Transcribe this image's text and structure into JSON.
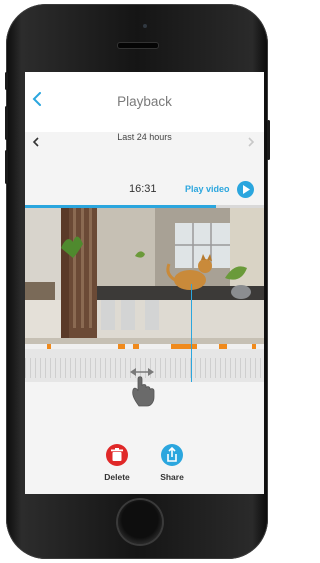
{
  "header": {
    "title": "Playback"
  },
  "range": {
    "label": "Last 24 hours"
  },
  "player": {
    "time": "16:31",
    "play_label": "Play video",
    "progress": 0.8
  },
  "timeline": {
    "events": [
      {
        "start": 0.09,
        "width": 0.02
      },
      {
        "start": 0.39,
        "width": 0.03
      },
      {
        "start": 0.45,
        "width": 0.025
      },
      {
        "start": 0.61,
        "width": 0.11
      },
      {
        "start": 0.81,
        "width": 0.035
      },
      {
        "start": 0.95,
        "width": 0.015
      }
    ],
    "cursor": 0.695
  },
  "actions": {
    "delete_label": "Delete",
    "share_label": "Share"
  },
  "colors": {
    "accent": "#2ba6de",
    "event": "#f08a1c",
    "delete": "#e02828"
  }
}
